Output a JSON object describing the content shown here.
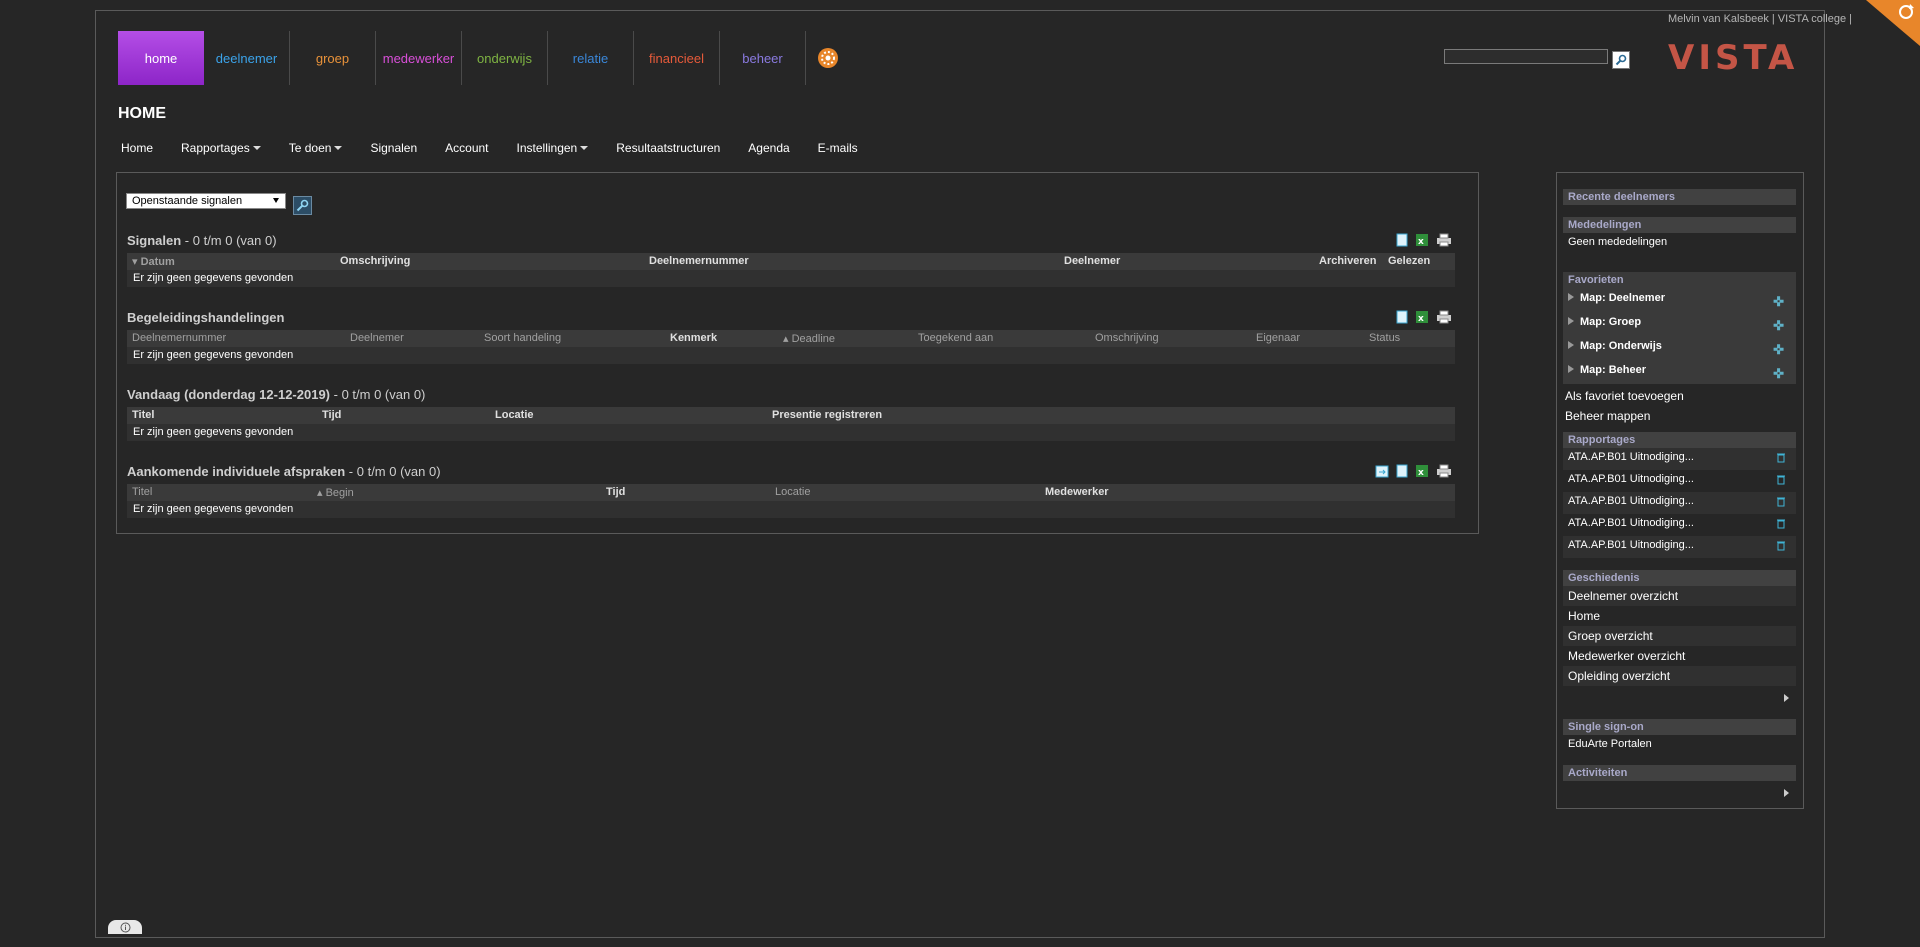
{
  "user_bar": "Melvin van Kalsbeek | VISTA college |",
  "logo_text": "VISTA",
  "top_nav": [
    {
      "label": "home",
      "color": "#ffffff"
    },
    {
      "label": "deelnemer",
      "color": "#3ba3ea"
    },
    {
      "label": "groep",
      "color": "#e8923a"
    },
    {
      "label": "medewerker",
      "color": "#d84fd8"
    },
    {
      "label": "onderwijs",
      "color": "#7fb443"
    },
    {
      "label": "relatie",
      "color": "#3a87d9"
    },
    {
      "label": "financieel",
      "color": "#e55a3a"
    },
    {
      "label": "beheer",
      "color": "#8a7ae0"
    }
  ],
  "gear_icon": "orange-gear-icon",
  "search": {
    "value": "",
    "placeholder": ""
  },
  "page_title": "HOME",
  "sub_nav": [
    {
      "label": "Home",
      "dropdown": false
    },
    {
      "label": "Rapportages",
      "dropdown": true
    },
    {
      "label": "Te doen",
      "dropdown": true
    },
    {
      "label": "Signalen",
      "dropdown": false
    },
    {
      "label": "Account",
      "dropdown": false
    },
    {
      "label": "Instellingen",
      "dropdown": true
    },
    {
      "label": "Resultaatstructuren",
      "dropdown": false
    },
    {
      "label": "Agenda",
      "dropdown": false
    },
    {
      "label": "E-mails",
      "dropdown": false
    }
  ],
  "filter": {
    "selected": "Openstaande signalen"
  },
  "sections": {
    "signalen": {
      "title": "Signalen",
      "count": " - 0 t/m 0 (van 0)",
      "columns": [
        "Datum",
        "Omschrijving",
        "Deelnemernummer",
        "Deelnemer",
        "Archiveren",
        "Gelezen"
      ],
      "empty": "Er zijn geen gegevens gevonden"
    },
    "begeleiding": {
      "title": "Begeleidingshandelingen",
      "count": "",
      "columns": [
        "Deelnemernummer",
        "Deelnemer",
        "Soort handeling",
        "Kenmerk",
        "Deadline",
        "Toegekend aan",
        "Omschrijving",
        "Eigenaar",
        "Status"
      ],
      "empty": "Er zijn geen gegevens gevonden"
    },
    "vandaag": {
      "title": "Vandaag (donderdag 12-12-2019)",
      "count": " - 0 t/m 0 (van 0)",
      "columns": [
        "Titel",
        "Tijd",
        "Locatie",
        "Presentie registreren"
      ],
      "empty": "Er zijn geen gegevens gevonden"
    },
    "afspraken": {
      "title": "Aankomende individuele afspraken",
      "count": " - 0 t/m 0 (van 0)",
      "columns": [
        "Titel",
        "Begin",
        "Tijd",
        "Locatie",
        "Medewerker"
      ],
      "empty": "Er zijn geen gegevens gevonden"
    }
  },
  "sidebar": {
    "recent": "Recente deelnemers",
    "mededelingen": {
      "title": "Mededelingen",
      "item": "Geen mededelingen"
    },
    "favorieten": {
      "title": "Favorieten",
      "items": [
        "Map: Deelnemer",
        "Map: Groep",
        "Map: Onderwijs",
        "Map: Beheer"
      ],
      "add": "Als favoriet toevoegen",
      "manage": "Beheer mappen"
    },
    "rapportages": {
      "title": "Rapportages",
      "items": [
        "ATA.AP.B01 Uitnodiging...",
        "ATA.AP.B01 Uitnodiging...",
        "ATA.AP.B01 Uitnodiging...",
        "ATA.AP.B01 Uitnodiging...",
        "ATA.AP.B01 Uitnodiging..."
      ]
    },
    "geschiedenis": {
      "title": "Geschiedenis",
      "items": [
        "Deelnemer overzicht",
        "Home",
        "Groep overzicht",
        "Medewerker overzicht",
        "Opleiding overzicht"
      ]
    },
    "sso": {
      "title": "Single sign-on",
      "item": "EduArte Portalen"
    },
    "activiteiten": {
      "title": "Activiteiten"
    }
  }
}
